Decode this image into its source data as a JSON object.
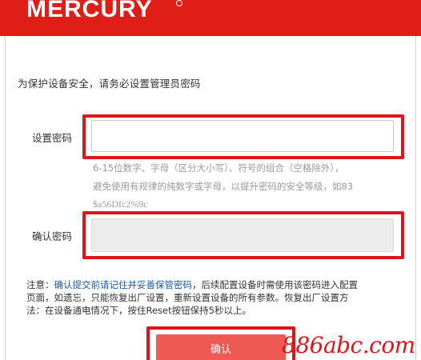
{
  "header": {
    "brand": "MERCURY"
  },
  "intro_text": "为保护设备安全，请务必设置管理员密码",
  "form": {
    "password_label": "设置密码",
    "password_value": "",
    "password_hint_lines": [
      "6-15位数字、字母（区分大小写）、符号的组合（空格除外），",
      "避免使用有规律的纯数字或字母，以提升密码的安全等级，如83",
      "$a56Dfc2%9c"
    ],
    "confirm_label": "确认密码",
    "confirm_value": ""
  },
  "note": {
    "prefix": "注意：",
    "link_text": "确认提交前请记住并妥善保管密码",
    "line1_rest": "，后续配置设备时需使用该密码进入配置",
    "line2": "页面，如遗忘，只能恢复出厂设置，重新设置设备的所有参数。恢复出厂设置方",
    "line3": "法：在设备通电情况下，按住Reset按钮保持5秒以上。"
  },
  "confirm_button_label": "确认",
  "watermark": "886abc.com",
  "colors": {
    "brand_red": "#df1f17",
    "highlight_red": "#e0151b",
    "button": "#ef5b52",
    "link": "#1a59a8"
  }
}
